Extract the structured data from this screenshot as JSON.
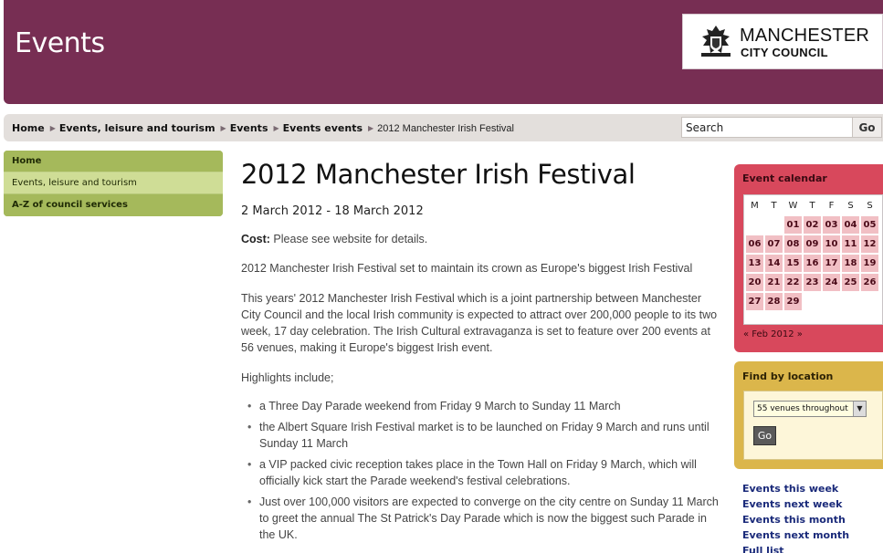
{
  "header": {
    "title": "Events",
    "logo": {
      "line1": "MANCHESTER",
      "line2": "CITY COUNCIL"
    }
  },
  "breadcrumb": {
    "items": [
      "Home",
      "Events, leisure and tourism",
      "Events",
      "Events events"
    ],
    "current": "2012 Manchester Irish Festival"
  },
  "search": {
    "value": "Search",
    "go_label": "Go"
  },
  "leftnav": {
    "home": "Home",
    "events_leisure": "Events, leisure and tourism",
    "az": "A-Z of council services"
  },
  "main": {
    "title": "2012 Manchester Irish Festival",
    "dates": "2 March 2012 - 18 March 2012",
    "cost_label": "Cost:",
    "cost_text": " Please see website for details.",
    "intro": "2012 Manchester Irish Festival set to maintain its crown as Europe's biggest Irish Festival",
    "body": "This years' 2012 Manchester Irish Festival which is a joint partnership between Manchester City Council and the local Irish community is expected to attract over 200,000 people to its two week, 17 day celebration. The Irish Cultural extravaganza is set to feature over 200 events at 56 venues, making it Europe's biggest Irish event.",
    "highlights_intro": "Highlights include;",
    "highlights": [
      "a Three Day Parade weekend from Friday 9 March to Sunday 11 March",
      "the Albert Square Irish Festival market is to be launched on Friday 9 March and runs until Sunday 11 March",
      "a VIP packed civic reception takes place in the Town Hall on Friday 9 March, which will officially kick start the Parade weekend's festival celebrations.",
      "Just over 100,000 visitors are expected to converge on the city centre on Sunday 11 March to greet the annual The St Patrick's Day Parade which is now the biggest such Parade in the UK."
    ]
  },
  "calendar": {
    "title": "Event calendar",
    "weekdays": [
      "M",
      "T",
      "W",
      "T",
      "F",
      "S",
      "S"
    ],
    "leading_blanks": 2,
    "days": [
      "01",
      "02",
      "03",
      "04",
      "05",
      "06",
      "07",
      "08",
      "09",
      "10",
      "11",
      "12",
      "13",
      "14",
      "15",
      "16",
      "17",
      "18",
      "19",
      "20",
      "21",
      "22",
      "23",
      "24",
      "25",
      "26",
      "27",
      "28",
      "29"
    ],
    "nav": "« Feb 2012 »"
  },
  "location": {
    "title": "Find by location",
    "selected": "55 venues throughout",
    "go_label": "Go"
  },
  "links": [
    "Events this week",
    "Events next week",
    "Events this month",
    "Events next month",
    "Full list"
  ],
  "colors": {
    "header": "#772e53",
    "nav_green": "#a8bd62",
    "calendar_red": "#d8485c",
    "location_gold": "#dbb64b",
    "link_blue": "#1a2a7a"
  },
  "icons": {
    "logo_crest": "coat-of-arms-icon",
    "dropdown": "chevron-down-icon",
    "crumb_separator": "triangle-right-icon"
  }
}
